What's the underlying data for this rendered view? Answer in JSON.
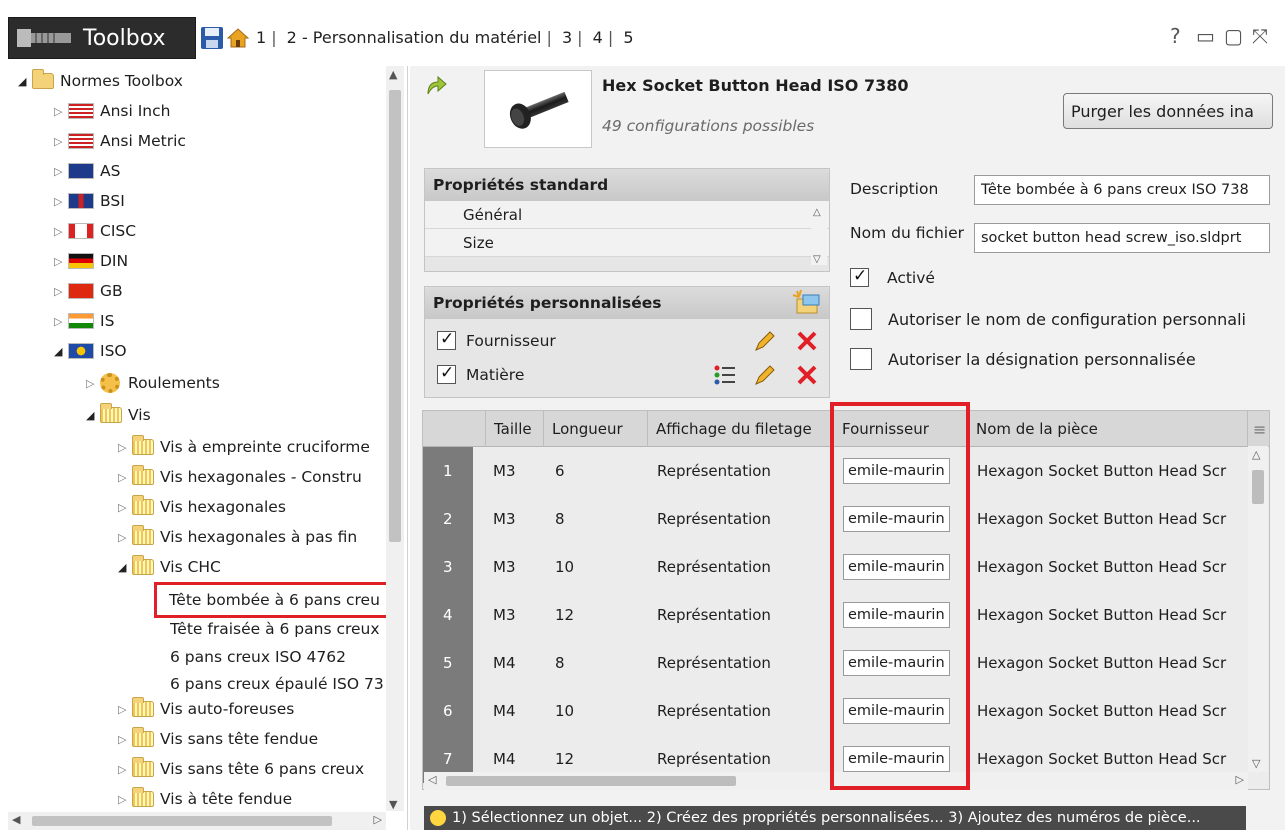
{
  "titlebar": {
    "app_title": "Toolbox",
    "breadcrumbs": [
      "1",
      "2 - Personnalisation du matériel",
      "3",
      "4",
      "5"
    ],
    "help_glyph": "?",
    "minimize_glyph": "▭",
    "restore_glyph": "▢",
    "close_glyph": "⤧"
  },
  "tree": {
    "root": "Normes Toolbox",
    "standards": [
      {
        "label": "Ansi Inch"
      },
      {
        "label": "Ansi Metric"
      },
      {
        "label": "AS"
      },
      {
        "label": "BSI"
      },
      {
        "label": "CISC"
      },
      {
        "label": "DIN"
      },
      {
        "label": "GB"
      },
      {
        "label": "IS"
      },
      {
        "label": "ISO"
      }
    ],
    "iso_children": {
      "roulements": "Roulements",
      "vis": "Vis"
    },
    "vis_children": [
      "Vis à empreinte cruciforme",
      "Vis hexagonales - Constru",
      "Vis hexagonales",
      "Vis hexagonales à pas fin",
      "Vis CHC"
    ],
    "vis_chc_children": [
      "Tête bombée à 6 pans creu",
      "Tête fraisée à 6 pans creux",
      "6 pans creux ISO 4762",
      "6 pans creux épaulé ISO 73"
    ],
    "vis_more": [
      "Vis auto-foreuses",
      "Vis sans tête fendue",
      "Vis sans tête 6 pans creux",
      "Vis à tête fendue"
    ]
  },
  "component": {
    "title": "Hex Socket Button Head ISO 7380",
    "subtitle": "49 configurations possibles",
    "purge_button": "Purger les données ina"
  },
  "standard_props": {
    "title": "Propriétés standard",
    "items": [
      "Général",
      "Size"
    ]
  },
  "custom_props": {
    "title": "Propriétés personnalisées",
    "items": [
      {
        "label": "Fournisseur",
        "checked": true
      },
      {
        "label": "Matière",
        "checked": true
      }
    ]
  },
  "details": {
    "description_label": "Description",
    "description_value": "Tête bombée à 6 pans creux ISO 738",
    "filename_label": "Nom du fichier",
    "filename_value": "socket button head screw_iso.sldprt",
    "active_label": "Activé",
    "active_checked": true,
    "allow_config_label": "Autoriser le nom de configuration personnali",
    "allow_config_checked": false,
    "allow_designation_label": "Autoriser la désignation personnalisée",
    "allow_designation_checked": false
  },
  "grid": {
    "columns": [
      "Taille",
      "Longueur",
      "Affichage du filetage",
      "Fournisseur",
      "Nom de la pièce"
    ],
    "rows": [
      {
        "idx": "1",
        "taille": "M3",
        "longueur": "6",
        "affichage": "Représentation",
        "fournisseur": "emile-maurin",
        "nom": "Hexagon Socket Button Head Scr"
      },
      {
        "idx": "2",
        "taille": "M3",
        "longueur": "8",
        "affichage": "Représentation",
        "fournisseur": "emile-maurin",
        "nom": "Hexagon Socket Button Head Scr"
      },
      {
        "idx": "3",
        "taille": "M3",
        "longueur": "10",
        "affichage": "Représentation",
        "fournisseur": "emile-maurin",
        "nom": "Hexagon Socket Button Head Scr"
      },
      {
        "idx": "4",
        "taille": "M3",
        "longueur": "12",
        "affichage": "Représentation",
        "fournisseur": "emile-maurin",
        "nom": "Hexagon Socket Button Head Scr"
      },
      {
        "idx": "5",
        "taille": "M4",
        "longueur": "8",
        "affichage": "Représentation",
        "fournisseur": "emile-maurin",
        "nom": "Hexagon Socket Button Head Scr"
      },
      {
        "idx": "6",
        "taille": "M4",
        "longueur": "10",
        "affichage": "Représentation",
        "fournisseur": "emile-maurin",
        "nom": "Hexagon Socket Button Head Scr"
      },
      {
        "idx": "7",
        "taille": "M4",
        "longueur": "12",
        "affichage": "Représentation",
        "fournisseur": "emile-maurin",
        "nom": "Hexagon Socket Button Head Scr"
      }
    ]
  },
  "hint": {
    "text": "1) Sélectionnez un objet... 2) Créez des propriétés personnalisées... 3) Ajoutez des numéros de pièce..."
  },
  "colors": {
    "highlight_red": "#e01f26",
    "title_dark": "#2c2c2c",
    "row_index_bg": "#7b7b7b"
  }
}
